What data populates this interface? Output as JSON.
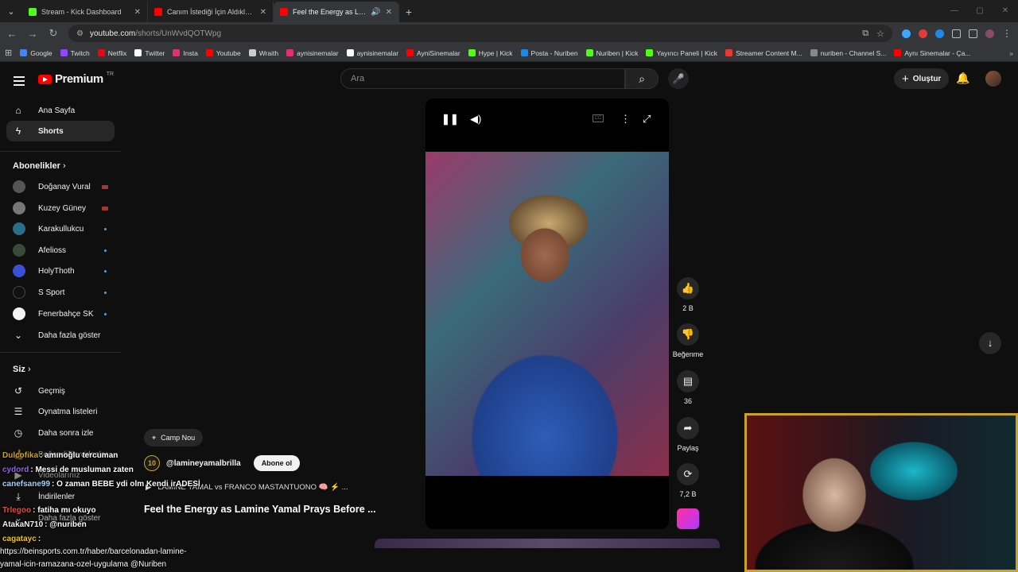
{
  "browser": {
    "tabs": [
      {
        "title": "Stream - Kick Dashboard",
        "color": "#53fc18"
      },
      {
        "title": "Canım İstediği İçin Aldıklarım! 🎮",
        "color": "#ff0000"
      },
      {
        "title": "Feel the Energy as Lamine Yamal",
        "color": "#ff0000"
      }
    ],
    "url_host": "youtube.com",
    "url_path": "/shorts/UnWvdQOTWpg",
    "bookmarks": [
      {
        "label": "Google",
        "color": "#4285f4"
      },
      {
        "label": "Twitch",
        "color": "#9146ff"
      },
      {
        "label": "Netflix",
        "color": "#e50914"
      },
      {
        "label": "Twitter",
        "color": "#ffffff"
      },
      {
        "label": "Insta",
        "color": "#e1306c"
      },
      {
        "label": "Youtube",
        "color": "#ff0000"
      },
      {
        "label": "Wraith",
        "color": "#cccccc"
      },
      {
        "label": "aynisinemalar",
        "color": "#e1306c"
      },
      {
        "label": "aynisinemalar",
        "color": "#ffffff"
      },
      {
        "label": "AyniSinemalar",
        "color": "#ff0000"
      },
      {
        "label": "Hype | Kick",
        "color": "#53fc18"
      },
      {
        "label": "Posta - Nuriben",
        "color": "#1e88e5"
      },
      {
        "label": "Nuriben | Kick",
        "color": "#53fc18"
      },
      {
        "label": "Yayıncı Paneli | Kick",
        "color": "#53fc18"
      },
      {
        "label": "Streamer Content M...",
        "color": "#e53935"
      },
      {
        "label": "nuriben - Channel S...",
        "color": "#888888"
      },
      {
        "label": "Aynı Sinemalar - Ça...",
        "color": "#ff0000"
      }
    ]
  },
  "header": {
    "logo_text": "Premium",
    "logo_country": "TR",
    "search_placeholder": "Ara",
    "create_label": "Oluştur"
  },
  "sidebar": {
    "main": [
      {
        "label": "Ana Sayfa",
        "icon": "home-icon"
      },
      {
        "label": "Shorts",
        "icon": "shorts-icon"
      }
    ],
    "subs_title": "Abonelikler",
    "subs": [
      {
        "label": "Doğanay Vural",
        "status": "live",
        "color": "#555555"
      },
      {
        "label": "Kuzey Güney",
        "status": "live",
        "color": "#777777"
      },
      {
        "label": "Karakullukcu",
        "status": "new",
        "color": "#2a6f8a"
      },
      {
        "label": "Afelioss",
        "status": "new",
        "color": "#3a4a3a"
      },
      {
        "label": "HolyThoth",
        "status": "new",
        "color": "#3b4fd4"
      },
      {
        "label": "S Sport",
        "status": "new",
        "color": "#111111"
      },
      {
        "label": "Fenerbahçe SK",
        "status": "new",
        "color": "#f5f5f5"
      }
    ],
    "show_more": "Daha fazla göster",
    "you_title": "Siz",
    "you_items": [
      {
        "label": "Geçmiş",
        "icon": "history-icon"
      },
      {
        "label": "Oynatma listeleri",
        "icon": "playlist-icon"
      },
      {
        "label": "Daha sonra izle",
        "icon": "clock-icon"
      },
      {
        "label": "Beğendiğin videolar",
        "icon": "like-icon"
      },
      {
        "label": "Videolarınız",
        "icon": "video-icon"
      },
      {
        "label": "İndirilenler",
        "icon": "download-icon"
      },
      {
        "label": "Daha fazla göster",
        "icon": "chevron-down-icon"
      }
    ]
  },
  "video": {
    "location": "Camp Nou",
    "channel": "@lamineyamalbrilla",
    "channel_badge": "10",
    "subscribe_label": "Abone ol",
    "related": "LAMINE YAMAL vs FRANCO MASTANTUONO 🧠 ⚡ ...",
    "title": "Feel the Energy as Lamine Yamal Prays Before ..."
  },
  "actions": {
    "likes": "2 B",
    "dislike_label": "Beğenme",
    "comments": "36",
    "share_label": "Paylaş",
    "remix_count": "7,2 B"
  },
  "chat": [
    {
      "user": "Dulcofika",
      "color": "#d4a017",
      "msg": ": amınoğlu tercuman"
    },
    {
      "user": "cydord",
      "color": "#9b59ff",
      "msg": ": Messi de musluman zaten"
    },
    {
      "user": "canefsane99",
      "color": "#9fd4ff",
      "msg": ": O zaman BEBE ydi olm Kendi irADESİ"
    },
    {
      "user": "Trlegoo",
      "color": "#e74c3c",
      "msg": ": fatiha mı okuyo"
    },
    {
      "user": "AtakaN710",
      "color": "#f1f1f1",
      "msg": ": @nuriben"
    },
    {
      "user": "cagatayc",
      "color": "#f1c40f",
      "msg": ":"
    }
  ],
  "chat_url_1": "https://beinsports.com.tr/haber/barcelonadan-lamine-",
  "chat_url_2": "yamal-icin-ramazana-ozel-uygulama @Nuriben"
}
